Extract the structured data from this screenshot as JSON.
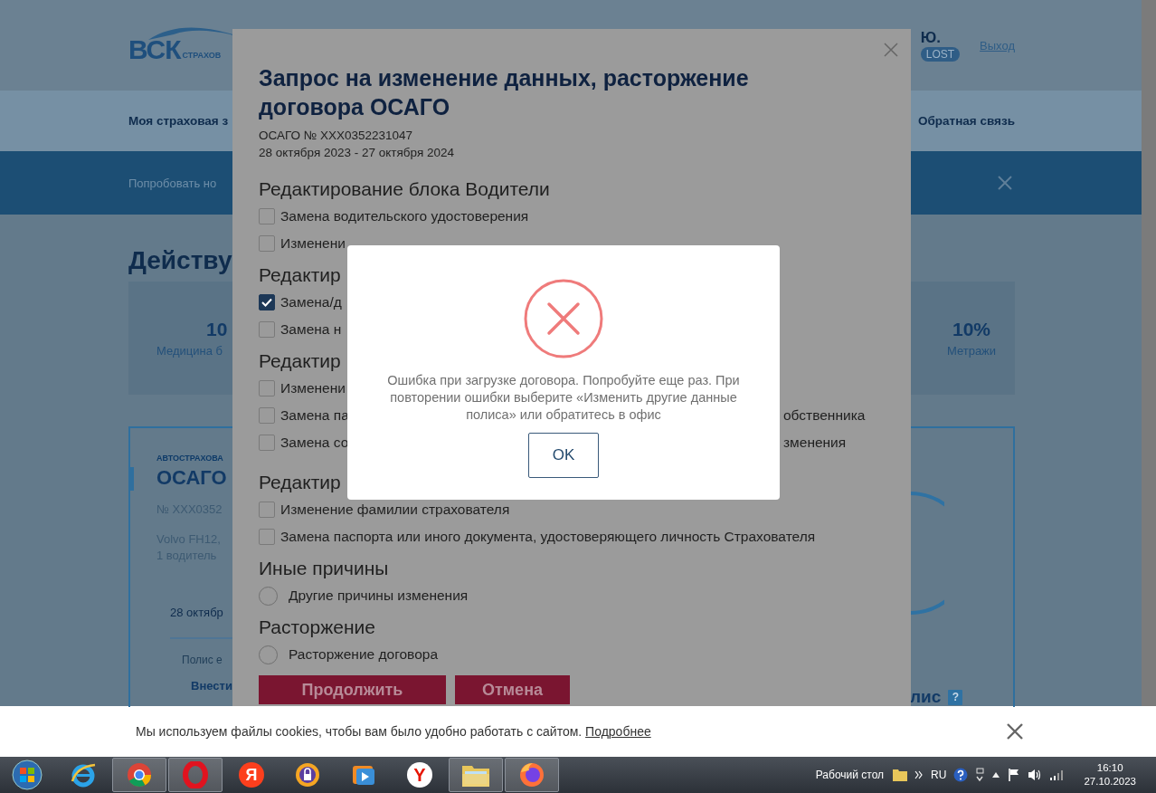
{
  "page": {
    "logo": {
      "mark": "ВСК",
      "sub": "СТРАХОВ"
    },
    "user": {
      "name": "Ю.",
      "badge": "LOST",
      "logout": "Выход"
    },
    "nav": {
      "left": "Моя страховая з",
      "right": "Обратная связь"
    },
    "banner": {
      "text": "Попробовать но"
    },
    "heading": "Действу",
    "stats": [
      {
        "value": "10",
        "label": "Медицина б"
      },
      {
        "value": "10%",
        "label": "Метражи"
      }
    ],
    "policy_card": {
      "category": "АВТОСТРАХОВА",
      "product": "ОСАГО",
      "number": "№ XXX0352",
      "vehicle": "Volvo FH12,",
      "drivers": "1 водитель",
      "date": "28 октябр",
      "note": "Полис е",
      "link": "Внести",
      "action": "лис",
      "help": "?"
    }
  },
  "modal": {
    "title": "Запрос на изменение данных, расторжение договора ОСАГО",
    "policy_number": "ОСАГО № XXX0352231047",
    "period": "28 октября 2023 - 27 октября 2024",
    "sections": [
      {
        "title": "Редактирование блока Водители",
        "options": [
          {
            "kind": "checkbox",
            "label": "Замена водительского удостоверения",
            "checked": false
          },
          {
            "kind": "checkbox",
            "label": "Изменени",
            "checked": false
          }
        ]
      },
      {
        "title": "Редактир",
        "options": [
          {
            "kind": "checkbox",
            "label": "Замена/д",
            "checked": true
          },
          {
            "kind": "checkbox",
            "label": "Замена н",
            "checked": false
          }
        ]
      },
      {
        "title": "Редактир",
        "options": [
          {
            "kind": "checkbox",
            "label": "Изменени",
            "checked": false
          },
          {
            "kind": "checkbox",
            "label": "Замена па",
            "tail": "обственника",
            "checked": false
          },
          {
            "kind": "checkbox",
            "label": "Замена со",
            "tail": "зменения",
            "checked": false
          }
        ]
      },
      {
        "title": "Редактир",
        "options": [
          {
            "kind": "checkbox",
            "label": "Изменение фамилии страхователя",
            "checked": false
          },
          {
            "kind": "checkbox",
            "label": "Замена паспорта или иного документа, удостоверяющего личность Страхователя",
            "checked": false
          }
        ]
      },
      {
        "title": "Иные причины",
        "options": [
          {
            "kind": "radio",
            "label": "Другие причины изменения",
            "checked": false
          }
        ]
      },
      {
        "title": "Расторжение",
        "options": [
          {
            "kind": "radio",
            "label": "Расторжение договора",
            "checked": false
          }
        ]
      }
    ],
    "buttons": [
      {
        "kind": "primary",
        "label": "Продолжить"
      },
      {
        "kind": "secondary",
        "label": "Отмена"
      }
    ]
  },
  "error_dialog": {
    "message": "Ошибка при загрузке договора. Попробуйте еще раз. При повторении ошибки выберите «Изменить другие данные полиса» или обратитесь в офис",
    "button": "OK"
  },
  "cookie_bar": {
    "text": "Мы используем файлы cookies, чтобы вам было удобно работать с сайтом.",
    "link": "Подробнее"
  },
  "taskbar": {
    "apps": [
      {
        "kind": "ie",
        "running": false
      },
      {
        "kind": "chrome",
        "running": true
      },
      {
        "kind": "opera",
        "running": true
      },
      {
        "kind": "yandex",
        "glyph": "Я",
        "running": false
      },
      {
        "kind": "lock",
        "running": false
      },
      {
        "kind": "player",
        "running": false
      },
      {
        "kind": "ybrowser",
        "glyph": "Y",
        "running": false
      },
      {
        "kind": "folder",
        "running": true
      },
      {
        "kind": "firefox",
        "running": true
      }
    ],
    "desktop": "Рабочий стол",
    "language": "RU",
    "time": "16:10",
    "date": "27.10.2023"
  }
}
